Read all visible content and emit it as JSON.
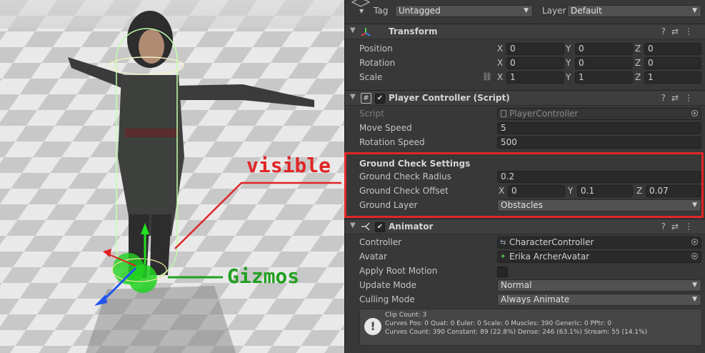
{
  "inspector": {
    "tag": {
      "label": "Tag",
      "value": "Untagged"
    },
    "layer": {
      "label": "Layer",
      "value": "Default"
    },
    "transform": {
      "title": "Transform",
      "position": {
        "label": "Position",
        "x": "0",
        "y": "0",
        "z": "0"
      },
      "rotation": {
        "label": "Rotation",
        "x": "0",
        "y": "0",
        "z": "0"
      },
      "scale": {
        "label": "Scale",
        "x": "1",
        "y": "1",
        "z": "1"
      }
    },
    "player_controller": {
      "title": "Player Controller (Script)",
      "enabled": "✔",
      "script": {
        "label": "Script",
        "value": "PlayerController"
      },
      "move_speed": {
        "label": "Move Speed",
        "value": "5"
      },
      "rotation_speed": {
        "label": "Rotation Speed",
        "value": "500"
      },
      "ground_section": "Ground Check Settings",
      "ground_check_radius": {
        "label": "Ground Check Radius",
        "value": "0.2"
      },
      "ground_check_offset": {
        "label": "Ground Check Offset",
        "x": "0",
        "y": "0.1",
        "z": "0.07"
      },
      "ground_layer": {
        "label": "Ground Layer",
        "value": "Obstacles"
      }
    },
    "animator": {
      "title": "Animator",
      "enabled": "✔",
      "controller": {
        "label": "Controller",
        "value": "CharacterController"
      },
      "avatar": {
        "label": "Avatar",
        "value": "Erika ArcherAvatar"
      },
      "apply_root_motion": {
        "label": "Apply Root Motion",
        "checked": false
      },
      "update_mode": {
        "label": "Update Mode",
        "value": "Normal"
      },
      "culling_mode": {
        "label": "Culling Mode",
        "value": "Always Animate"
      },
      "info": {
        "clip_count": "Clip Count: 3",
        "curves_pos": "Curves Pos: 0 Quat: 0 Euler: 0 Scale: 0 Muscles: 390 Generic: 0 PPtr: 0",
        "curves_count": "Curves Count: 390 Constant: 89 (22.8%) Dense: 246 (63.1%) Stream: 55 (14.1%)"
      }
    },
    "axes": {
      "x": "X",
      "y": "Y",
      "z": "Z"
    }
  },
  "annotations": {
    "visible": "visible",
    "gizmos": "Gizmos",
    "visible_color": "#e02626",
    "gizmos_color": "#22a022"
  },
  "icons": [
    "gameobject-icon",
    "transform-icon",
    "script-icon",
    "animator-icon",
    "help-icon",
    "preset-icon",
    "menu-icon",
    "link-icon",
    "warning-icon",
    "object-picker-icon"
  ]
}
